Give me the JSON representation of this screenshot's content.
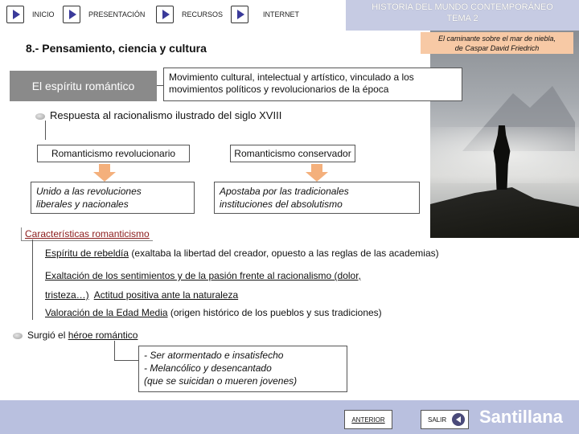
{
  "nav": {
    "inicio": "INICIO",
    "presentacion": "PRESENTACIÓN",
    "recursos": "RECURSOS",
    "internet": "INTERNET"
  },
  "header": {
    "line1": "HISTORIA DEL MUNDO CONTEMPORÁNEO",
    "line2": "TEMA 2"
  },
  "caption": {
    "line1": "El caminante sobre el mar de niebla,",
    "line2": "de Caspar David Friedrich"
  },
  "title": "8.- Pensamiento, ciencia y cultura",
  "spirit": {
    "label": "El espíritu romántico",
    "desc_line1": "Movimiento cultural, intelectual y artístico, vinculado a los",
    "desc_line2": "movimientos políticos y revolucionarios de la época"
  },
  "response": "Respuesta al racionalismo ilustrado del siglo XVIII",
  "types": [
    {
      "label": "Romanticismo revolucionario",
      "desc_line1": "Unido a las revoluciones",
      "desc_line2": "liberales y nacionales"
    },
    {
      "label": "Romanticismo conservador",
      "desc_line1": "Apostaba por las tradicionales",
      "desc_line2": "instituciones del absolutismo"
    }
  ],
  "characteristics": {
    "title": "Características romanticismo",
    "items": [
      {
        "key": "Espíritu de rebeldía",
        "rest": " (exaltaba la libertad del creador, opuesto a las reglas de las  academias)"
      },
      {
        "key": "Exaltación de los sentimientos y de la pasión frente al racionalismo (dolor,",
        "rest": ""
      },
      {
        "key": "tristeza…)",
        "mid": "  ",
        "key2": "Actitud positiva ante la naturaleza",
        "rest": ""
      },
      {
        "key": "Valoración de la Edad Media",
        "rest": " (origen histórico de los pueblos y sus tradiciones)"
      }
    ]
  },
  "hero": {
    "prefix": "Surgió el ",
    "key": "héroe romántico",
    "lines": [
      "- Ser atormentado e insatisfecho",
      "- Melancólico y desencantado",
      "(que se suicidan o mueren jovenes)"
    ]
  },
  "footer": {
    "anterior": "ANTERIOR",
    "salir": "SALIR",
    "brand": "Santillana"
  }
}
